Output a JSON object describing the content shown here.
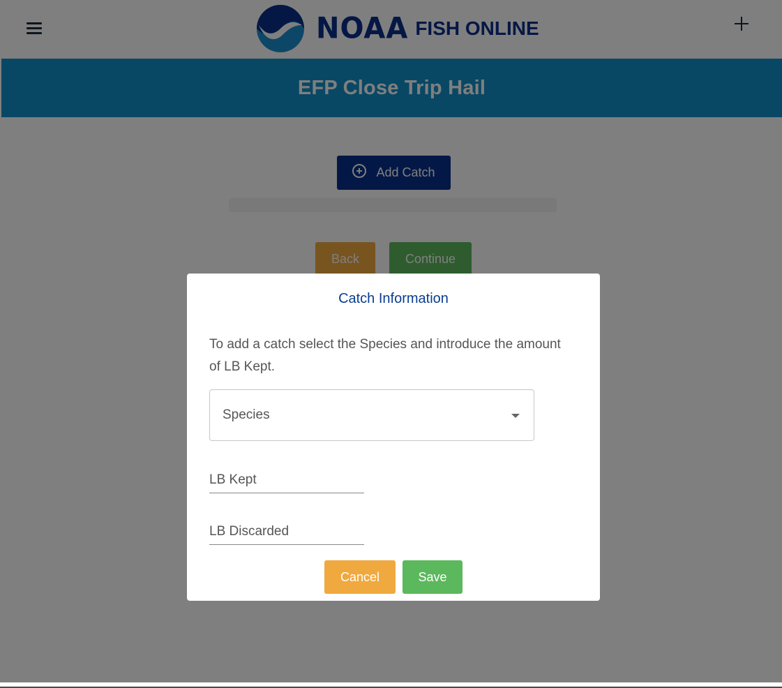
{
  "brand": {
    "logo_icon": "noaa-bird-logo-icon",
    "noaa_text": "NOAA",
    "app_name": "FISH ONLINE",
    "color": "#0a2f8a"
  },
  "topbar": {
    "menu_icon": "hamburger-menu-icon",
    "add_icon": "plus-icon"
  },
  "header": {
    "title": "EFP Close Trip Hail",
    "color": "#1291c9"
  },
  "main": {
    "add_catch_label": "Add Catch",
    "add_catch_icon": "plus-circle-icon",
    "back_label": "Back",
    "continue_label": "Continue"
  },
  "modal": {
    "title": "Catch Information",
    "description": "To add a catch select the Species and introduce the amount of LB Kept.",
    "species_select": {
      "placeholder": "Species",
      "icon": "caret-down-icon"
    },
    "fields": {
      "lb_kept_label": "LB Kept",
      "lb_discarded_label": "LB Discarded"
    },
    "cancel_label": "Cancel",
    "save_label": "Save"
  },
  "colors": {
    "primary_button": "#07308d",
    "warning_button": "#f0a93e",
    "success_button": "#5cb85c",
    "overlay": "rgba(0,0,0,0.5)"
  }
}
